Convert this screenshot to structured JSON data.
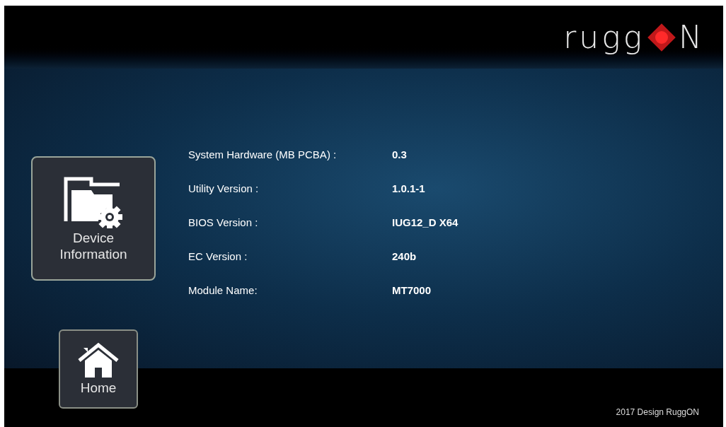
{
  "logo": {
    "text_before": "rugg",
    "text_after": "N"
  },
  "sidebar": [
    {
      "label": "Device Information",
      "kind": "device"
    }
  ],
  "info_rows": [
    {
      "label": "System Hardware (MB PCBA) :",
      "value": "0.3"
    },
    {
      "label": "Utility Version :",
      "value": "1.0.1-1"
    },
    {
      "label": "BIOS Version :",
      "value": "IUG12_D X64"
    },
    {
      "label": "EC Version :",
      "value": "240b"
    },
    {
      "label": "Module Name:",
      "value": "MT7000"
    }
  ],
  "home_button": {
    "label": "Home"
  },
  "footer": {
    "text": "2017 Design RuggON"
  }
}
